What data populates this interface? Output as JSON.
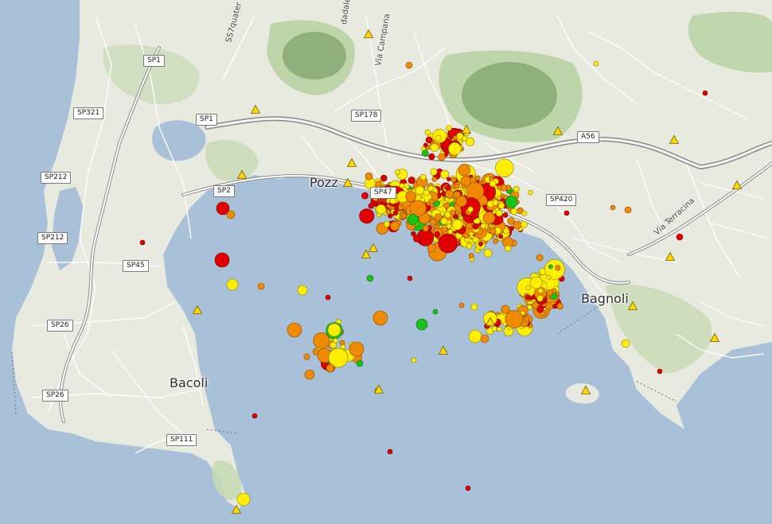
{
  "place_labels": {
    "pozzuoli": "Pozz",
    "bagnoli": "Bagnoli",
    "bacoli": "Bacoli"
  },
  "road_shields": {
    "sp1_a": "SP1",
    "sp1_b": "SP1",
    "sp321": "SP321",
    "sp178": "SP178",
    "a56": "A56",
    "sp212_a": "SP212",
    "sp212_b": "SP212",
    "sp2": "SP2",
    "sp47": "SP47",
    "sp420": "SP420",
    "sp45": "SP45",
    "sp26_a": "SP26",
    "sp26_b": "SP26",
    "sp111": "SP111"
  },
  "street_labels": {
    "ss7": "SS7quater",
    "via_campana": "Via Campana",
    "dadale": "dadale",
    "via_terracina": "Via Terracina"
  },
  "colors": {
    "sea": "#a9c1d8",
    "land": "#e8eadf",
    "green_hill": "#b9d2a3",
    "crater": "#8fb07a",
    "road_major": "#8a8a8a",
    "road_minor": "#ffffff",
    "event_red": "#e00000",
    "event_orange": "#f08a00",
    "event_yellow": "#ffee00",
    "event_green": "#19c219",
    "station_marker": "#ffd700",
    "epicenter_star": "#e02020"
  },
  "legend_semantics": {
    "marker_types": [
      "earthquake-event",
      "seismic-station",
      "epicenter-star"
    ]
  }
}
